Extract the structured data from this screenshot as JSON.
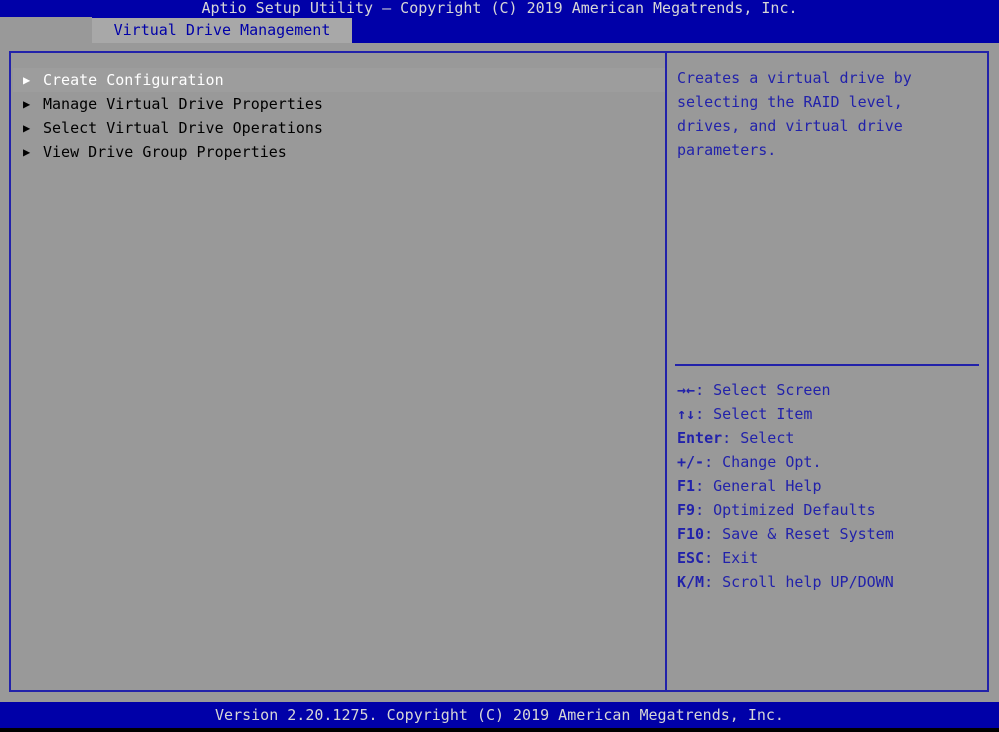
{
  "header": {
    "title": "Aptio Setup Utility – Copyright (C) 2019 American Megatrends, Inc."
  },
  "tab": {
    "label": "Virtual Drive Management"
  },
  "menu": {
    "items": [
      {
        "bullet": "▶",
        "label": "Create Configuration",
        "selected": true
      },
      {
        "bullet": "▶",
        "label": "Manage Virtual Drive Properties",
        "selected": false
      },
      {
        "bullet": "▶",
        "label": "Select Virtual Drive Operations",
        "selected": false
      },
      {
        "bullet": "▶",
        "label": "View Drive Group Properties",
        "selected": false
      }
    ]
  },
  "help": {
    "description": "Creates a virtual drive by\nselecting the RAID level,\ndrives, and virtual drive\nparameters.",
    "hotkeys": [
      {
        "keys": "→←",
        "action": ": Select Screen"
      },
      {
        "keys": "↑↓",
        "action": ": Select Item"
      },
      {
        "keys": "Enter",
        "action": ": Select"
      },
      {
        "keys": "+/-",
        "action": ": Change Opt."
      },
      {
        "keys": "F1",
        "action": ": General Help"
      },
      {
        "keys": "F9",
        "action": ": Optimized Defaults"
      },
      {
        "keys": "F10",
        "action": ": Save & Reset System"
      },
      {
        "keys": "ESC",
        "action": ": Exit"
      },
      {
        "keys": "K/M",
        "action": ": Scroll help UP/DOWN"
      }
    ]
  },
  "footer": {
    "version": "Version 2.20.1275. Copyright (C) 2019 American Megatrends, Inc."
  },
  "colors": {
    "blue": "#0000a8",
    "border_blue": "#2222aa",
    "gray": "#999999",
    "tab_gray": "#a8a8a8",
    "text_light": "#d6d6d6",
    "selected_text": "#ffffff",
    "item_text": "#000000"
  }
}
